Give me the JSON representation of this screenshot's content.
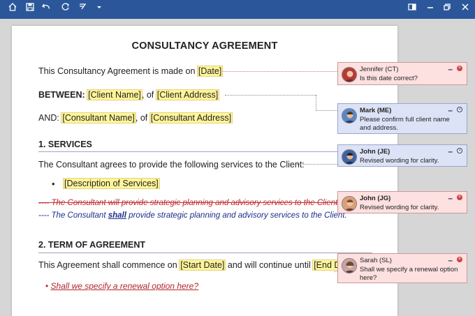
{
  "toolbar": {
    "icons": [
      "home-icon",
      "save-icon",
      "undo-icon",
      "redo-icon",
      "format-icon",
      "dropdown-icon",
      "reading-mode-icon",
      "minimize-icon",
      "restore-icon",
      "close-icon"
    ],
    "accent": "#2b579a"
  },
  "document": {
    "title": "CONSULTANCY AGREEMENT",
    "intro_text": "This Consultancy Agreement is made on ",
    "date_field": "[Date]",
    "between_label": "BETWEEN:",
    "client_name": "[Client Name]",
    "comma_of_1": ", of ",
    "client_address": "[Client Address]",
    "and_label": "AND:",
    "consultant_name": "[Consultant Name]",
    "comma_of_2": ", of ",
    "consultant_address": "[Consultant Address]",
    "section1_heading": "1.  SERVICES",
    "services_intro": "The Consultant agrees to provide the following services to the Client:",
    "bullet_glyph": "•",
    "services_desc": "[Description of Services]",
    "deleted_prefix": "----",
    "deleted_text": "The Consultant will provide strategic planning and advisory services to the Client.",
    "inserted_prefix": "----",
    "inserted_a": "The Consultant ",
    "inserted_shall": "shall",
    "inserted_b": " provide strategic planning and advisory services to the Client.",
    "section2_heading": "2.  TERM OF AGREEMENT",
    "term_a": "This Agreement shall commence on ",
    "start_date": "[Start Date]",
    "term_b": " and will continue until ",
    "end_date": "[End Date]",
    "term_c": ".",
    "renewal_bullet": "•",
    "renewal_text": "Shall we specify a renewal option here?"
  },
  "comments": [
    {
      "author": "Jennifer (CT)",
      "text": "Is this date correct?",
      "color": "#fde0e0"
    },
    {
      "author": "Mark (ME)",
      "text": "Please confirm full client name and address.",
      "color": "#dde3f6"
    },
    {
      "author": "John (JE)",
      "text": "Revised wording for clarity.",
      "color": "#dde3f6"
    },
    {
      "author": "John (JG)",
      "text": "Revised wording for clarity.",
      "color": "#fde0e0"
    },
    {
      "author": "Sarah (SL)",
      "text": "Shall we specify a renewal option here?",
      "color": "#fde0e0"
    }
  ],
  "comment_controls": {
    "minimize": "–",
    "close": "×"
  }
}
